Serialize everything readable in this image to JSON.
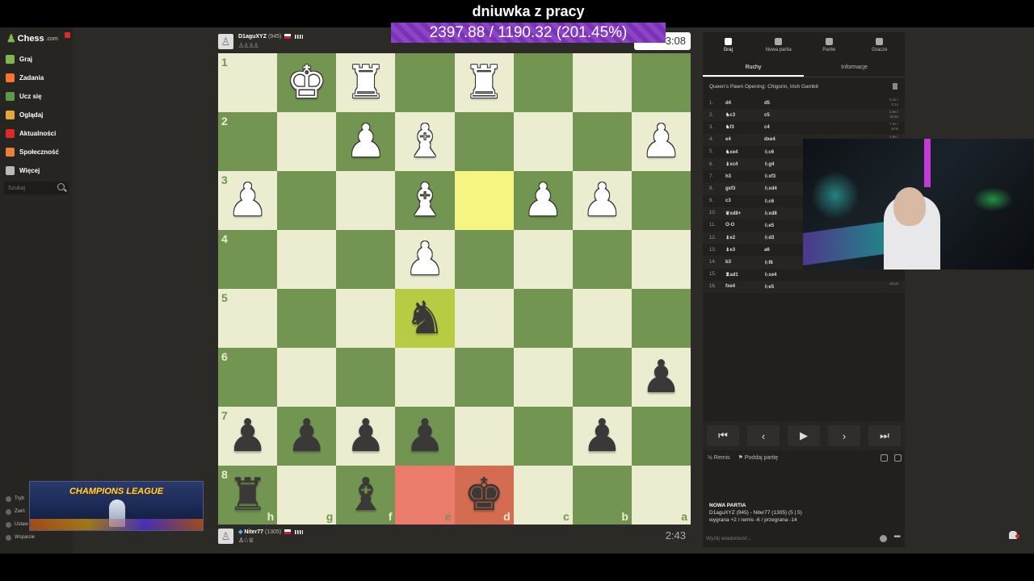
{
  "stream": {
    "title": "dniuwka z pracy",
    "stat": "2397.88 / 1190.32 (201.45%)"
  },
  "sidebar": {
    "logo": "Chess",
    "logo_suffix": ".com",
    "items": [
      {
        "label": "Graj",
        "icon": "play-icon",
        "color": "#81b64c"
      },
      {
        "label": "Zadania",
        "icon": "puzzle-icon",
        "color": "#f2762e"
      },
      {
        "label": "Ucz się",
        "icon": "learn-icon",
        "color": "#5d9948"
      },
      {
        "label": "Oglądaj",
        "icon": "watch-icon",
        "color": "#e3a83b"
      },
      {
        "label": "Aktualności",
        "icon": "news-icon",
        "color": "#e02828"
      },
      {
        "label": "Społeczność",
        "icon": "community-icon",
        "color": "#e8823a"
      },
      {
        "label": "Więcej",
        "icon": "more-icon",
        "color": "#bbbbbb"
      }
    ],
    "search_placeholder": "Szukaj",
    "bottom": [
      "Tryb",
      "Zwiń",
      "Ustaw",
      "Wsparcie"
    ]
  },
  "top_player": {
    "name": "D1aguXYZ",
    "rating": "(945)",
    "clock": "3:08"
  },
  "bottom_player": {
    "name": "Niter77",
    "rating": "(1305)",
    "clock": "2:43"
  },
  "board": {
    "ranks": [
      "1",
      "2",
      "3",
      "4",
      "5",
      "6",
      "7",
      "8"
    ],
    "files": [
      "h",
      "g",
      "f",
      "e",
      "d",
      "c",
      "b",
      "a"
    ],
    "rows": [
      [
        null,
        "wK",
        "wR",
        null,
        "wR",
        null,
        null,
        null
      ],
      [
        null,
        null,
        "wP",
        "wB",
        null,
        null,
        null,
        "wP"
      ],
      [
        "wP",
        null,
        null,
        "wB",
        null,
        "wP",
        "wP",
        null
      ],
      [
        null,
        null,
        null,
        "wP",
        null,
        null,
        null,
        null
      ],
      [
        null,
        null,
        null,
        "bN",
        null,
        null,
        null,
        null
      ],
      [
        null,
        null,
        null,
        null,
        null,
        null,
        null,
        "bP"
      ],
      [
        "bP",
        "bP",
        "bP",
        "bP",
        null,
        null,
        "bP",
        null
      ],
      [
        "bR",
        null,
        "bB",
        null,
        "bK",
        null,
        null,
        null
      ]
    ],
    "highlights": {
      "2-4": "hl-yellow",
      "4-3": "hl-green",
      "7-3": "hl-red",
      "7-4": "hl-redd"
    }
  },
  "right_panel": {
    "tabs": [
      "Graj",
      "Nowa partia",
      "Partie",
      "Gracze"
    ],
    "subtabs": [
      "Ruchy",
      "Informacje"
    ],
    "opening": "Queen's Pawn Opening: Chigorin, Irish Gambit",
    "moves": [
      {
        "n": "1.",
        "w": "d4",
        "b": "d5",
        "t": "0.1s / 0.1s"
      },
      {
        "n": "2.",
        "w": "♞c3",
        "b": "c5",
        "t": "2.6s / 15.6s"
      },
      {
        "n": "3.",
        "w": "♞f3",
        "b": "c4",
        "t": "7.2s / 8.0s"
      },
      {
        "n": "4.",
        "w": "e4",
        "b": "dxe4",
        "t": "1.5s / 26.8s"
      },
      {
        "n": "5.",
        "w": "♞xe4",
        "b": "♘c6",
        "t": ""
      },
      {
        "n": "6.",
        "w": "♝xc4",
        "b": "♘g4",
        "t": ""
      },
      {
        "n": "7.",
        "w": "h3",
        "b": "♘xf3",
        "t": ""
      },
      {
        "n": "8.",
        "w": "gxf3",
        "b": "♘xd4",
        "t": ""
      },
      {
        "n": "9.",
        "w": "c3",
        "b": "♘c6",
        "t": ""
      },
      {
        "n": "10.",
        "w": "♛xd8+",
        "b": "♘xd8",
        "t": ""
      },
      {
        "n": "11.",
        "w": "O-O",
        "b": "♘e5",
        "t": ""
      },
      {
        "n": "12.",
        "w": "♝e2",
        "b": "♘d3",
        "t": ""
      },
      {
        "n": "13.",
        "w": "♝e3",
        "b": "a6",
        "t": ""
      },
      {
        "n": "14.",
        "w": "b3",
        "b": "♘f6",
        "t": ""
      },
      {
        "n": "15.",
        "w": "♜ad1",
        "b": "♘xe4",
        "t": ""
      },
      {
        "n": "16.",
        "w": "fxe4",
        "b": "♘e5",
        "t": "29.0s"
      }
    ],
    "controls": [
      "⏮",
      "‹",
      "▶",
      "›",
      "⏭"
    ],
    "draw": "Remis",
    "resign": "Poddaj partię",
    "game_title": "NOWA PARTIA",
    "game_players": "D1aguXYZ (945) - Niter77 (1305) (5 | 5)",
    "game_stakes": "wygrana +2 / remis -6 / przegrana -14",
    "chat_placeholder": "Wyślij wiadomość..."
  },
  "banner": {
    "text": "CHAMPIONS LEAGUE"
  }
}
